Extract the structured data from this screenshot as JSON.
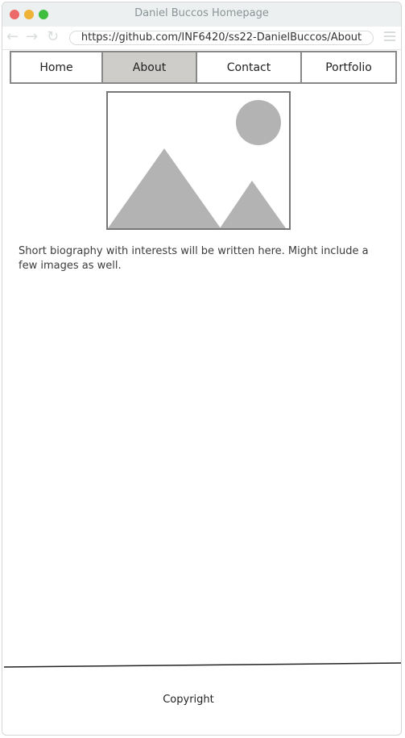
{
  "browser": {
    "window_title": "Daniel Buccos Homepage",
    "url": "https://github.com/INF6420/ss22-DanielBuccos/About",
    "back_icon": "back-arrow-icon",
    "forward_icon": "forward-arrow-icon",
    "reload_icon": "reload-icon",
    "menu_icon": "hamburger-menu-icon"
  },
  "nav": {
    "items": [
      {
        "label": "Home",
        "active": false
      },
      {
        "label": "About",
        "active": true
      },
      {
        "label": "Contact",
        "active": false
      },
      {
        "label": "Portfolio",
        "active": false
      }
    ],
    "active_color": "#cfcdca"
  },
  "main": {
    "image_icon": "image-placeholder-icon",
    "bio_text": "Short biography with interests will be written here. Might include a few images as well."
  },
  "footer": {
    "copyright": "Copyright"
  }
}
